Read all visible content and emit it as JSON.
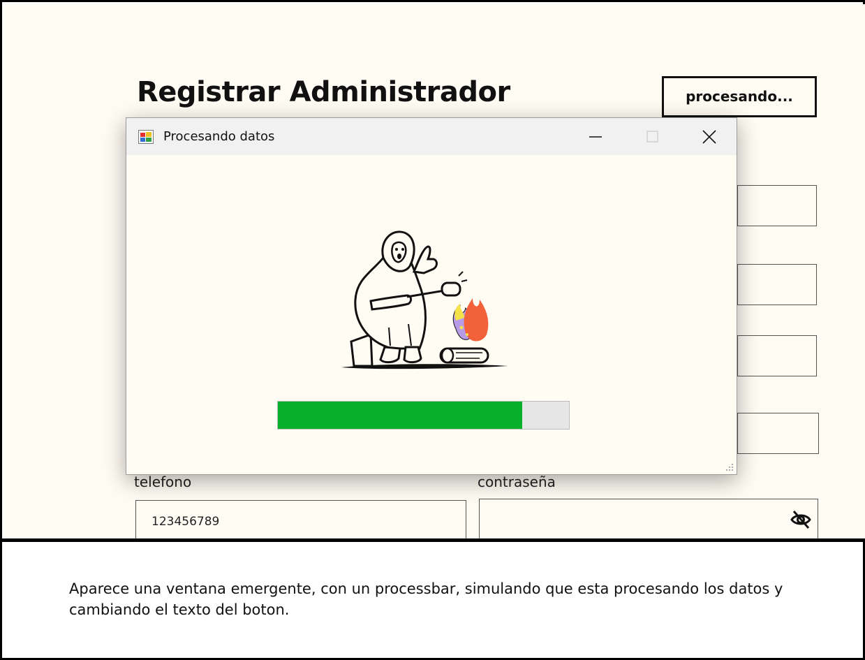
{
  "form": {
    "title": "Registrar Administrador",
    "process_button": "procesando...",
    "telefono_label": "telefono",
    "telefono_value": "123456789",
    "password_label": "contraseña"
  },
  "dialog": {
    "title": "Procesando datos",
    "progress": 0.84,
    "progress_color": "#06b02b"
  },
  "caption": "Aparece una ventana emergente, con un processbar, simulando que esta procesando los datos y cambiando el texto del boton."
}
